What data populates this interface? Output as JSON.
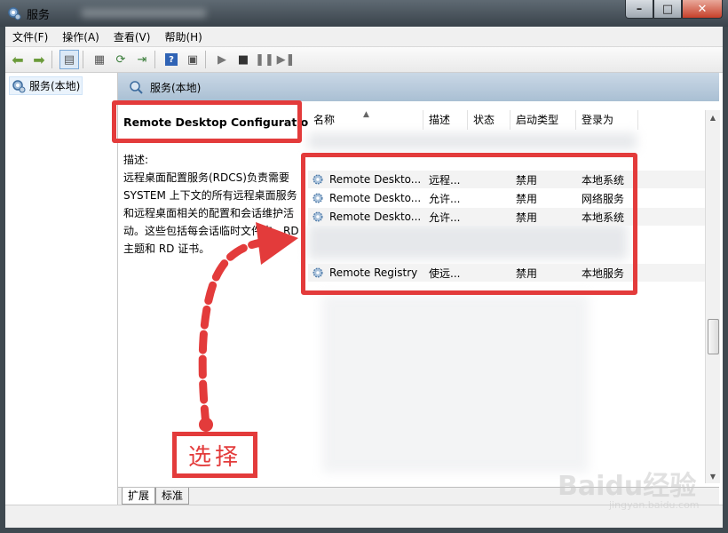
{
  "window": {
    "title": "服务"
  },
  "menu": {
    "items": [
      "文件(F)",
      "操作(A)",
      "查看(V)",
      "帮助(H)"
    ]
  },
  "tree": {
    "root_label": "服务(本地)"
  },
  "main_header": {
    "title": "服务(本地)"
  },
  "details": {
    "service_name": "Remote Desktop Configuration",
    "desc_label": "描述:",
    "desc_lines": [
      "远程桌面配置服务(RDCS)负责需要",
      "SYSTEM 上下文的所有远程桌面服务",
      "和远程桌面相关的配置和会话维护活",
      "动。这些包括每会话临时文件夹、RD",
      "主题和 RD 证书。"
    ]
  },
  "columns": [
    "名称",
    "描述",
    "状态",
    "启动类型",
    "登录为"
  ],
  "rows": [
    {
      "name": "Remote Deskto...",
      "desc": "远程...",
      "status": "",
      "startup": "禁用",
      "logon": "本地系统"
    },
    {
      "name": "Remote Deskto...",
      "desc": "允许...",
      "status": "",
      "startup": "禁用",
      "logon": "网络服务"
    },
    {
      "name": "Remote Deskto...",
      "desc": "允许...",
      "status": "",
      "startup": "禁用",
      "logon": "本地系统"
    },
    {
      "name": "Remote Registry",
      "desc": "使远...",
      "status": "",
      "startup": "禁用",
      "logon": "本地服务"
    }
  ],
  "tabs": {
    "extended": "扩展",
    "standard": "标准"
  },
  "annotation": {
    "label": "选择"
  },
  "watermark": {
    "brand": "Baidu经验",
    "url": "jingyan.baidu.com"
  },
  "colors": {
    "highlight_red": "#e33b3b",
    "header_blue": "#b7cadc"
  }
}
